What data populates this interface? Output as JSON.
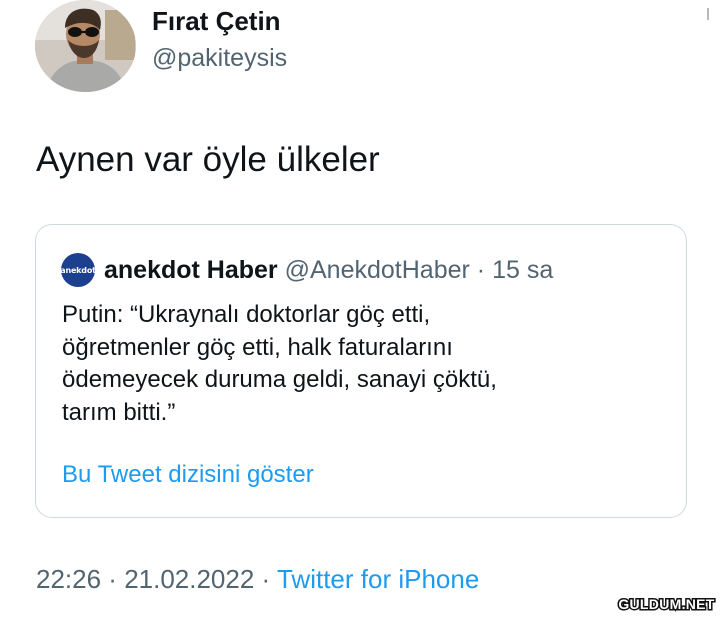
{
  "author": {
    "display_name": "Fırat Çetin",
    "handle": "@pakiteysis"
  },
  "tweet": {
    "text": "Aynen var öyle ülkeler"
  },
  "quote": {
    "avatar_text": "anekdot",
    "name": "anekdot Haber",
    "handle": "@AnekdotHaber",
    "separator": " · ",
    "time": "15 sa",
    "body_lines": [
      "Putin: “Ukraynalı doktorlar göç etti,",
      "öğretmenler göç etti, halk faturalarını",
      "ödemeyecek duruma geldi, sanayi çöktü,",
      "tarım bitti.”"
    ],
    "link_label": "Bu Tweet dizisini göster"
  },
  "footer": {
    "time": "22:26",
    "separator": " · ",
    "date": "21.02.2022",
    "source": "Twitter for iPhone"
  },
  "watermark": {
    "text": "GULDUM.NET"
  },
  "colors": {
    "text_primary": "#0f1419",
    "text_secondary": "#536471",
    "link": "#1d9bf0",
    "border": "#cfd9de",
    "quote_avatar_bg": "#1d3f8f"
  }
}
